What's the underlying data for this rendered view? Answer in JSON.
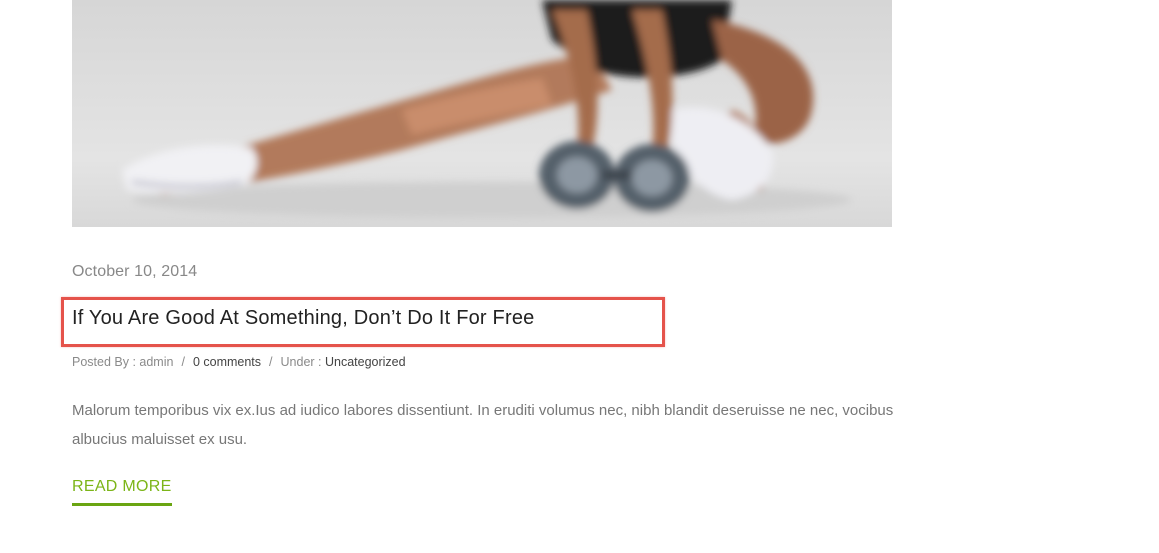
{
  "post": {
    "image_alt": "Woman exercising with dumbbells",
    "date": "October 10, 2014",
    "title": "If You Are Good At Something, Don’t Do It For Free",
    "meta": {
      "posted_by_label": "Posted By : ",
      "author": "admin",
      "separator": "/",
      "comments": "0 comments",
      "under_label": "Under : ",
      "category": "Uncategorized"
    },
    "excerpt": "Malorum temporibus vix ex.Ius ad iudico labores dissentiunt. In eruditi volumus nec, nibh blandit deseruisse ne nec, vocibus albucius maluisset ex usu.",
    "read_more": "READ MORE"
  },
  "colors": {
    "accent": "#7cb518",
    "highlight": "#e5534b"
  }
}
